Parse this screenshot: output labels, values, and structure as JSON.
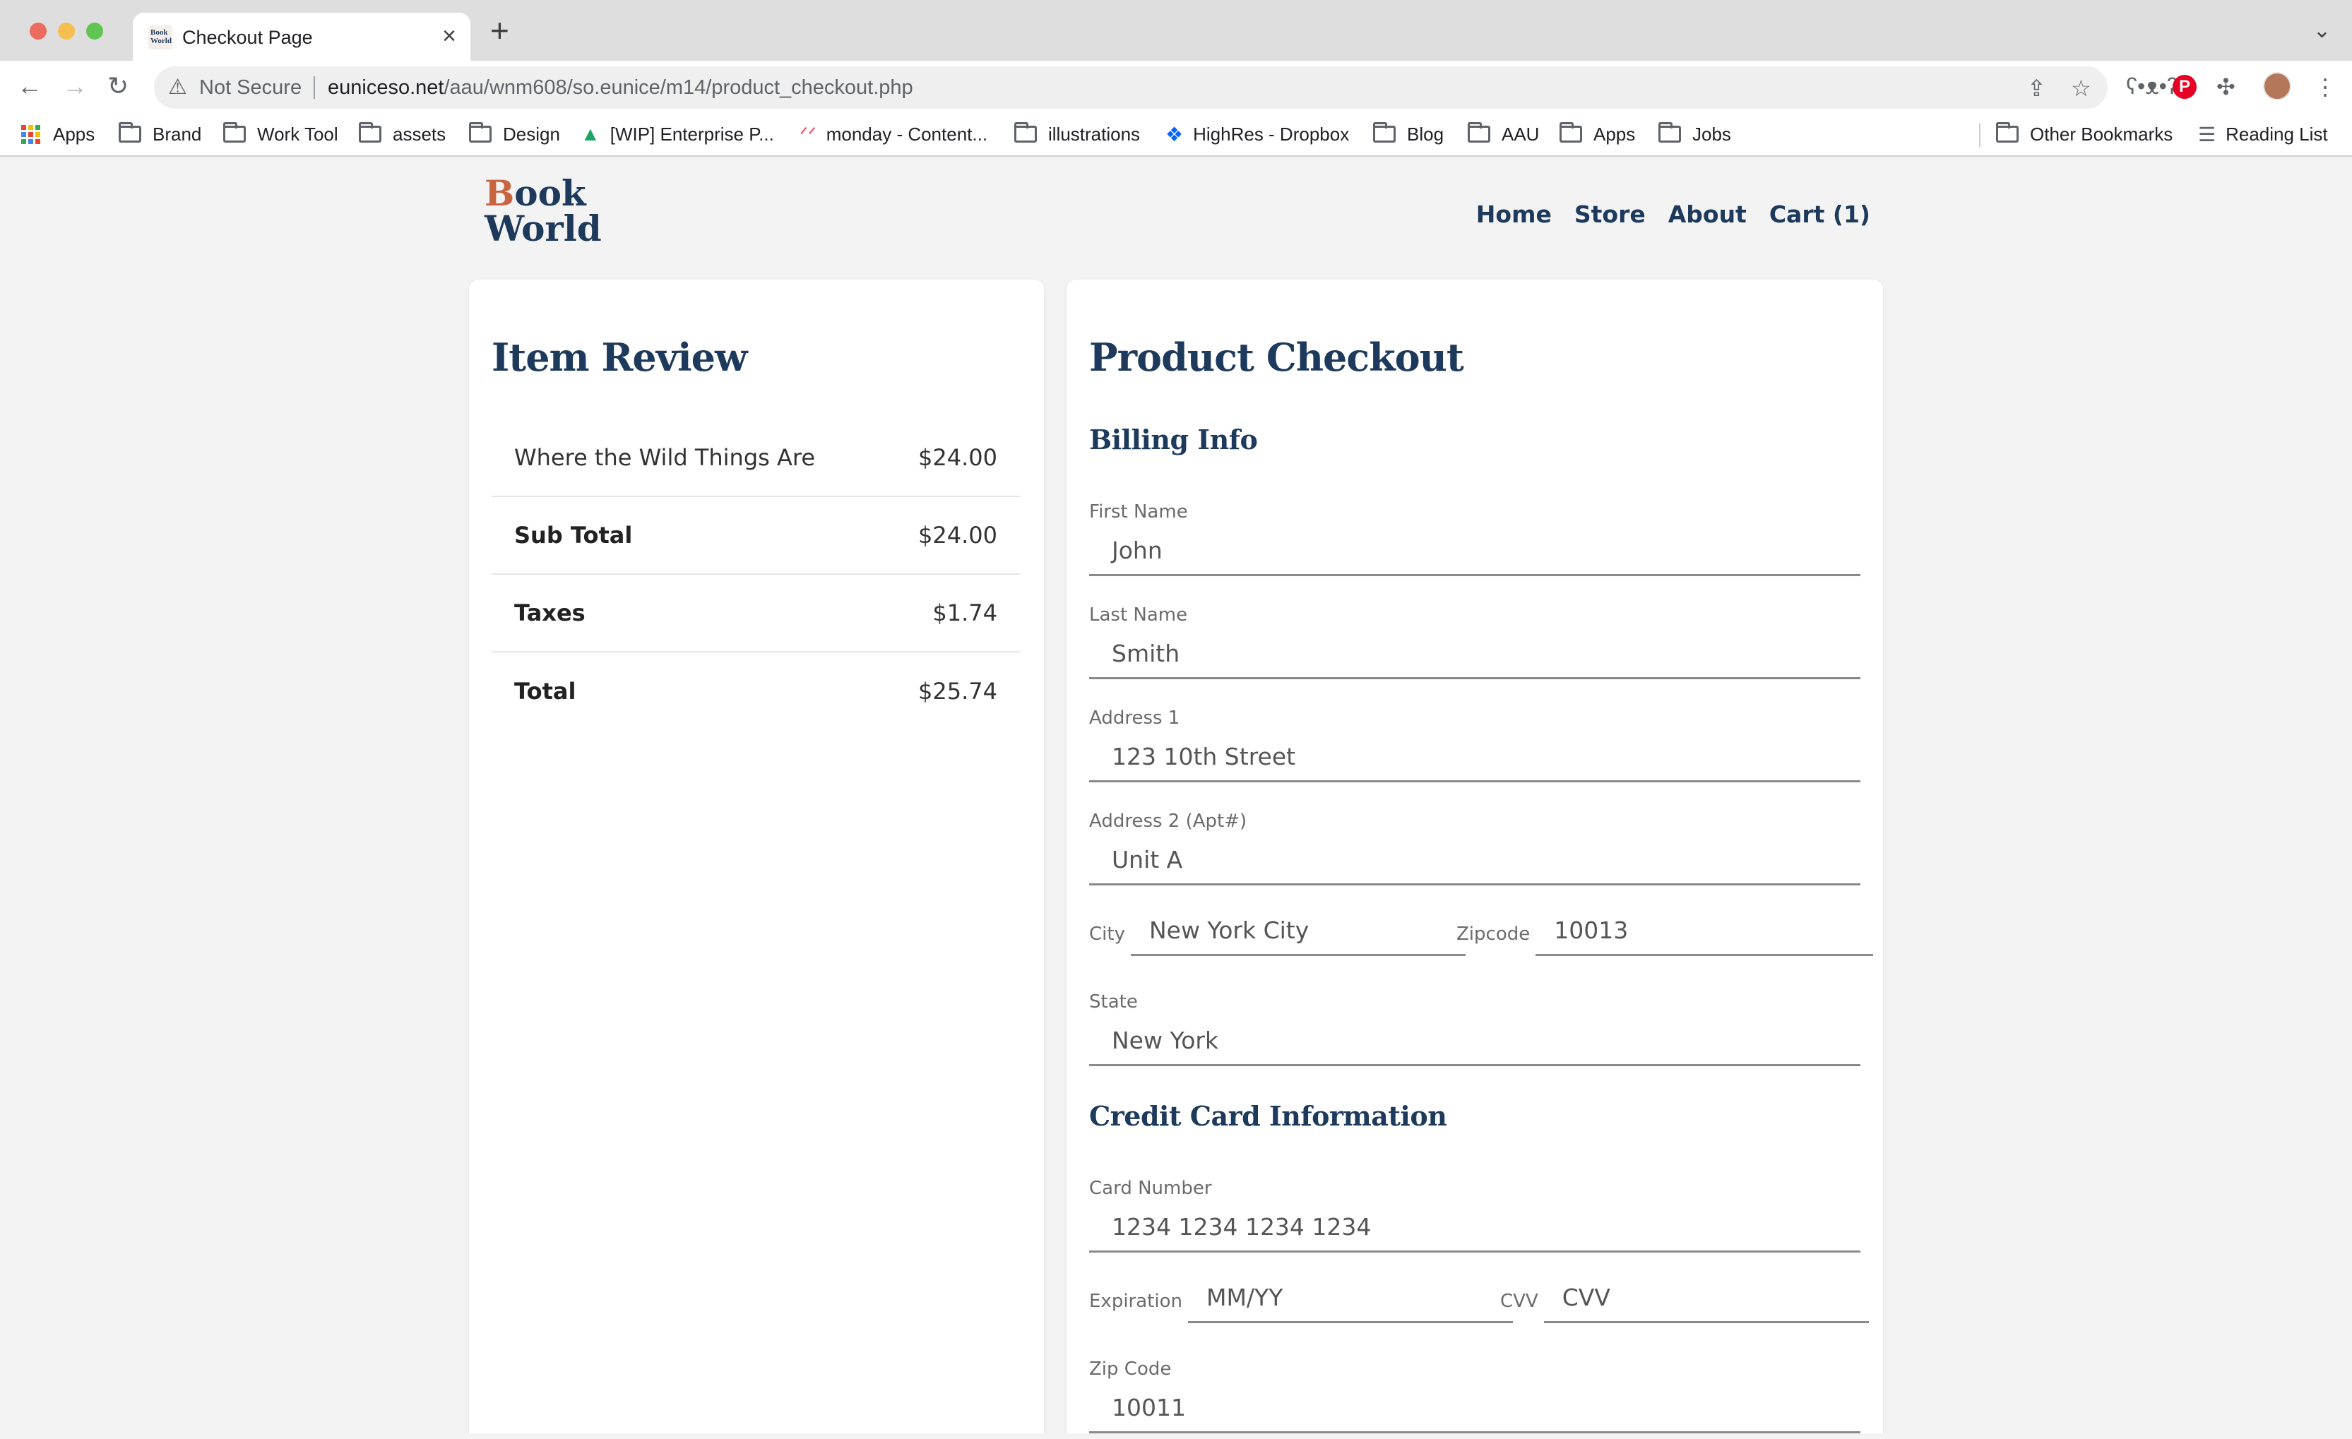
{
  "browser": {
    "tab_title": "Checkout Page",
    "favicon_text": "Book World",
    "not_secure": "Not Secure",
    "url_host": "euniceso.net",
    "url_path": "/aau/wnm608/so.eunice/m14/product_checkout.php",
    "bookmarks": [
      "Apps",
      "Brand",
      "Work Tool",
      "assets",
      "Design",
      "[WIP] Enterprise P...",
      "monday - Content...",
      "illustrations",
      "HighRes - Dropbox",
      "Blog",
      "AAU",
      "Apps",
      "Jobs"
    ],
    "other_bookmarks": "Other Bookmarks",
    "reading_list": "Reading List"
  },
  "site": {
    "logo_line1_initial": "B",
    "logo_line1_rest": "ook",
    "logo_line2": "World",
    "nav": [
      "Home",
      "Store",
      "About",
      "Cart (1)"
    ]
  },
  "review": {
    "title": "Item Review",
    "rows": [
      {
        "label": "Where the Wild Things Are",
        "value": "$24.00"
      },
      {
        "label": "Sub Total",
        "value": "$24.00"
      },
      {
        "label": "Taxes",
        "value": "$1.74"
      },
      {
        "label": "Total",
        "value": "$25.74"
      }
    ]
  },
  "checkout": {
    "title": "Product Checkout",
    "billing_title": "Billing Info",
    "first_name": {
      "label": "First Name",
      "value": "John"
    },
    "last_name": {
      "label": "Last Name",
      "value": "Smith"
    },
    "address1": {
      "label": "Address 1",
      "value": "123 10th Street"
    },
    "address2": {
      "label": "Address 2 (Apt#)",
      "value": "Unit A"
    },
    "city": {
      "label": "City",
      "value": "New York City"
    },
    "zipcode": {
      "label": "Zipcode",
      "value": "10013"
    },
    "state": {
      "label": "State",
      "value": "New York"
    },
    "cc_title": "Credit Card Information",
    "card_number": {
      "label": "Card Number",
      "value": "1234 1234 1234 1234"
    },
    "expiration": {
      "label": "Expiration",
      "value": "MM/YY"
    },
    "cvv": {
      "label": "CVV",
      "value": "CVV"
    },
    "zip_code": {
      "label": "Zip Code",
      "value": "10011"
    }
  },
  "colors": {
    "brand_navy": "#1d3a5c",
    "brand_orange": "#c86540",
    "page_bg": "#f3f3f3"
  }
}
